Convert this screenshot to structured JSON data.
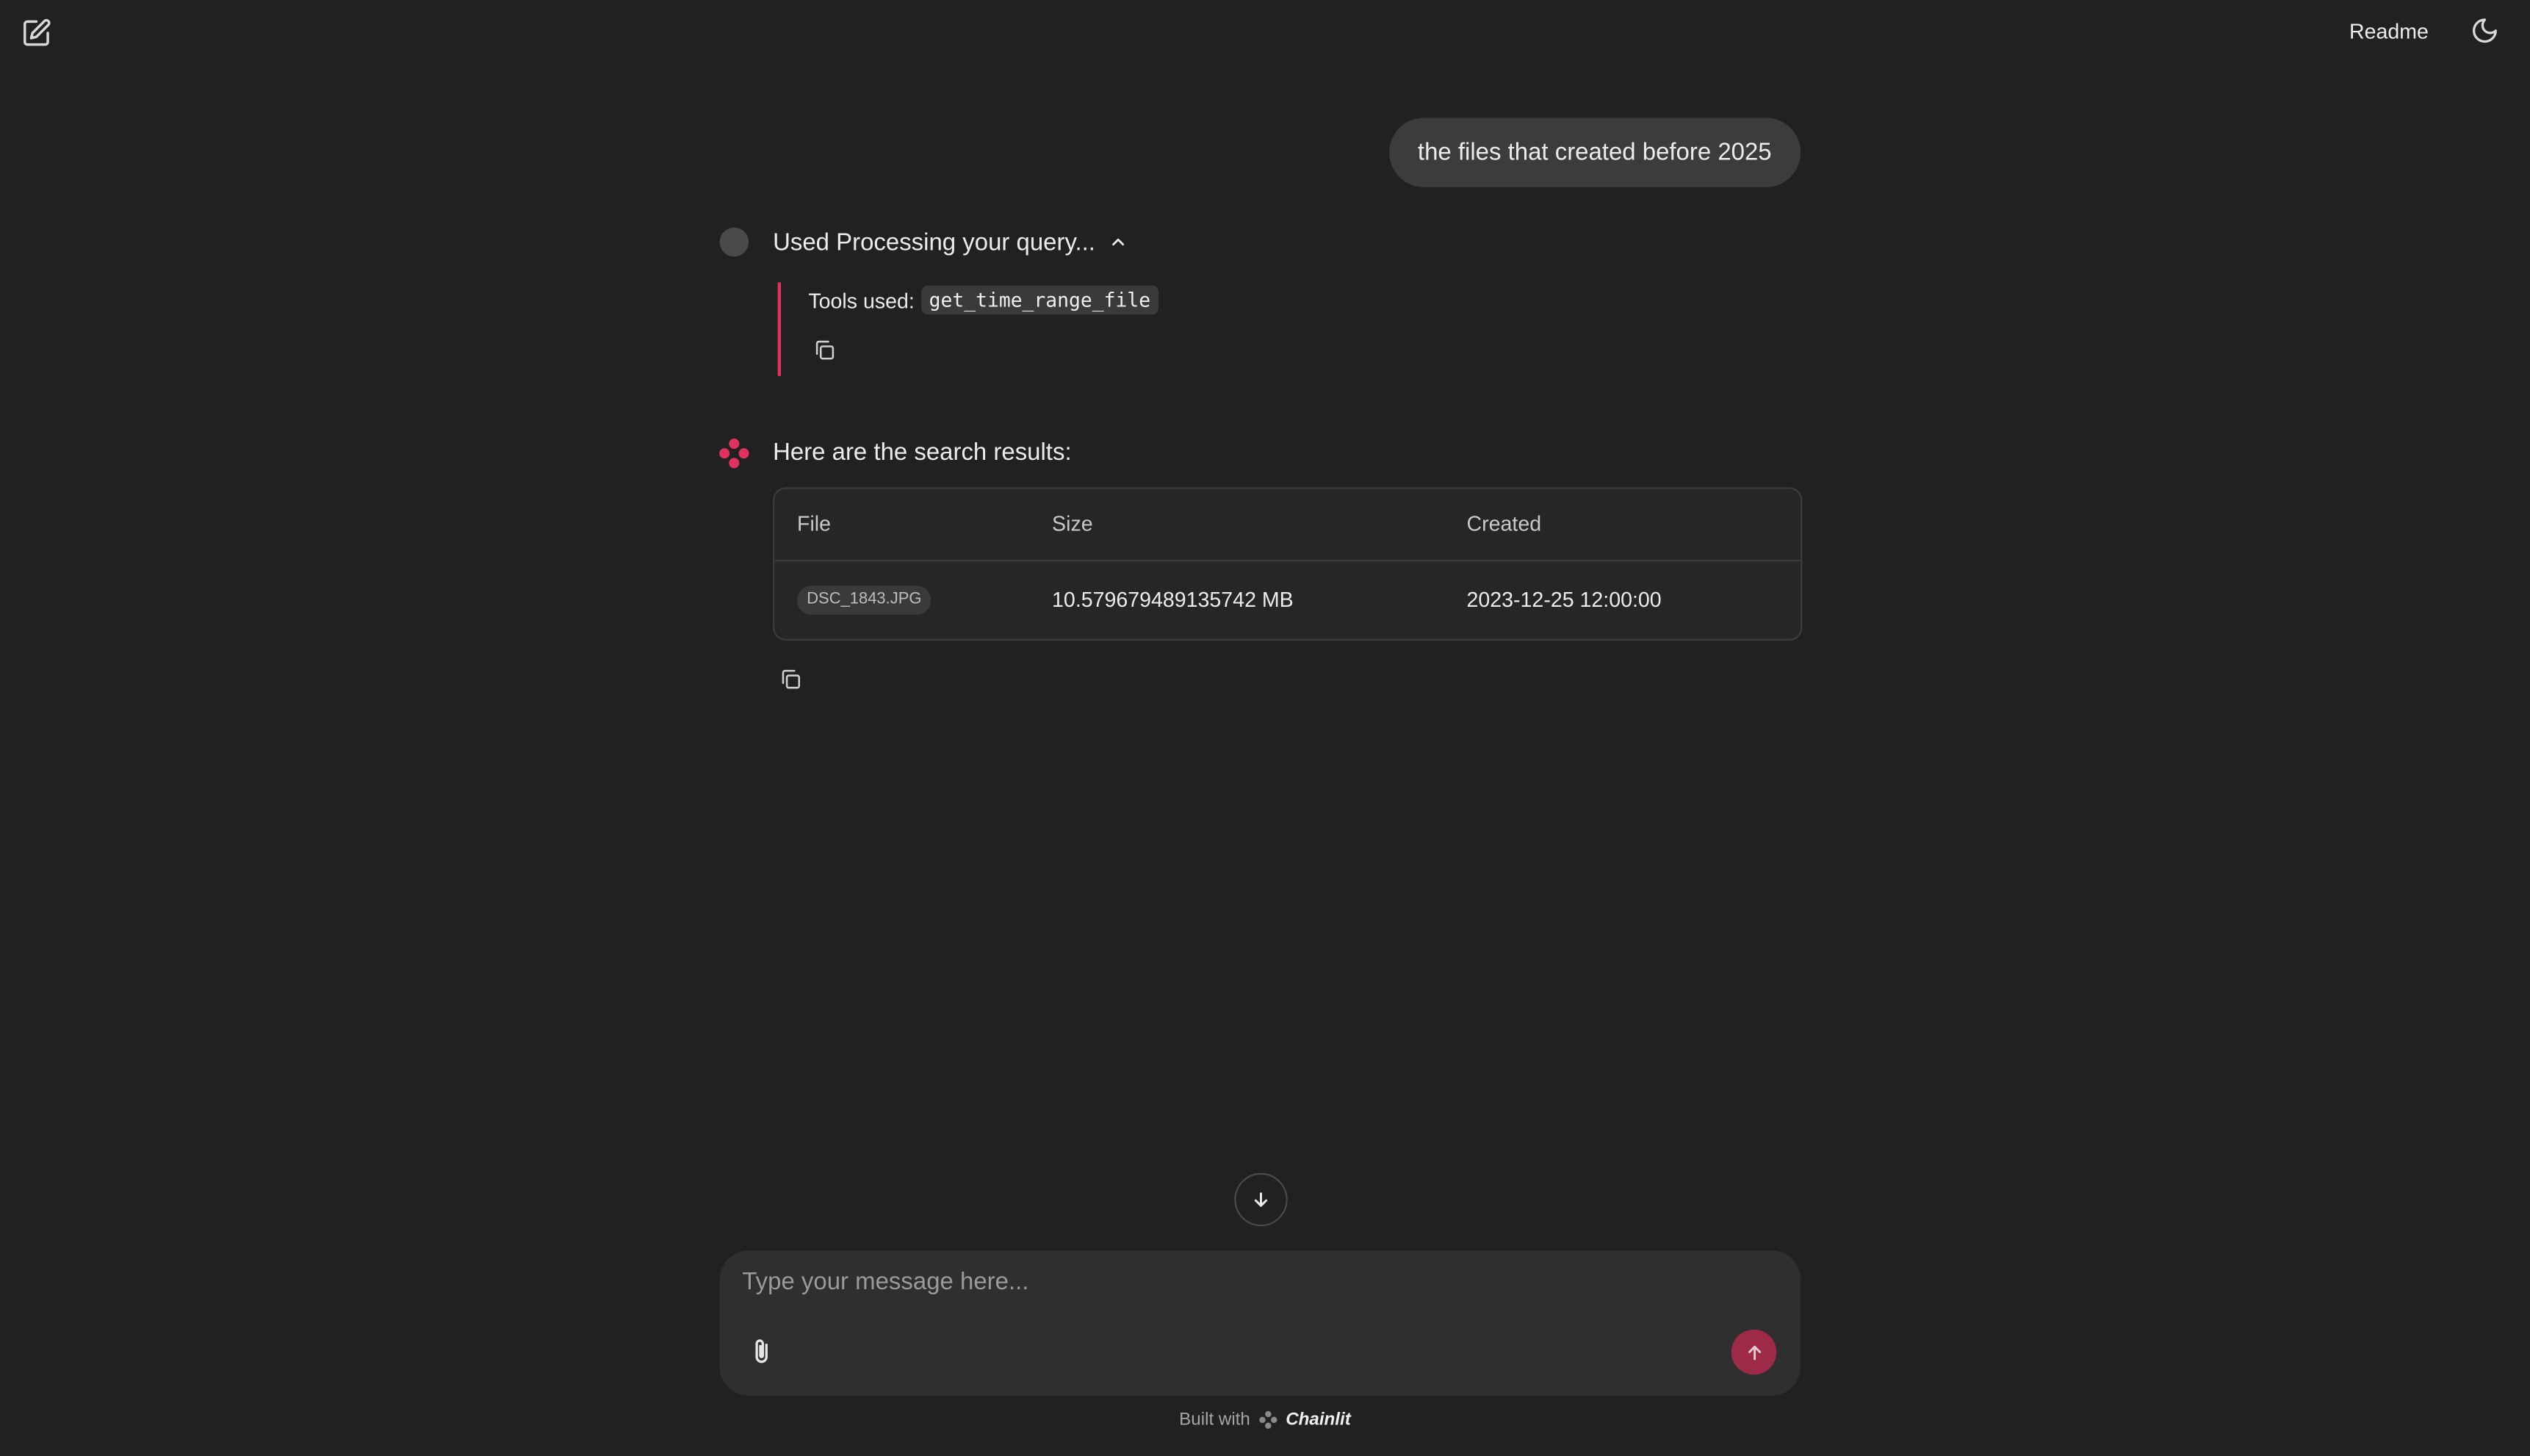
{
  "header": {
    "readme_label": "Readme",
    "icons": {
      "new_chat": "edit-square-icon",
      "theme": "moon-icon"
    }
  },
  "conversation": {
    "user_message": "the files that created before 2025",
    "step": {
      "title": "Used Processing your query...",
      "tools_prefix": "Tools used:",
      "tool_name": "get_time_range_file",
      "expanded": true
    },
    "assistant": {
      "intro": "Here are the search results:",
      "accent_color": "#e0325f",
      "table": {
        "headers": [
          "File",
          "Size",
          "Created"
        ],
        "rows": [
          {
            "file": "DSC_1843.JPG",
            "size": "10.579679489135742 MB",
            "created": "2023-12-25 12:00:00"
          }
        ]
      }
    }
  },
  "composer": {
    "placeholder": "Type your message here...",
    "value": "",
    "send_color": "#9d2a46"
  },
  "footer": {
    "built_with": "Built with",
    "brand": "Chainlit"
  }
}
